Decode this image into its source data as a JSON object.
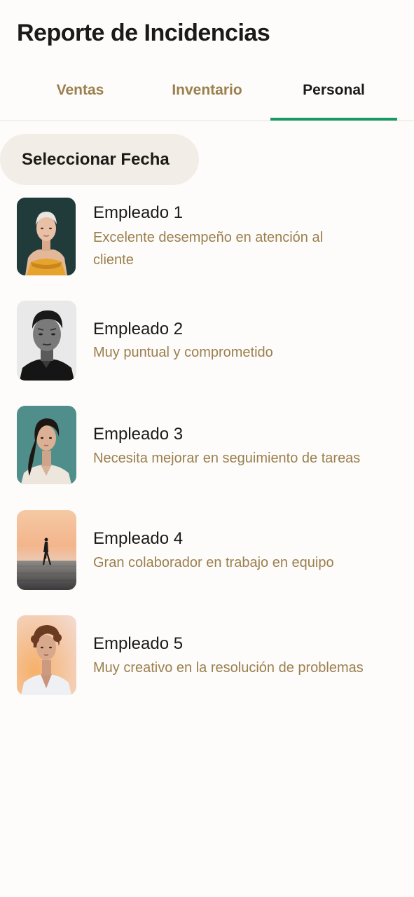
{
  "header": {
    "title": "Reporte de Incidencias"
  },
  "tabs": [
    {
      "label": "Ventas",
      "active": false
    },
    {
      "label": "Inventario",
      "active": false
    },
    {
      "label": "Personal",
      "active": true
    }
  ],
  "date_filter": {
    "label": "Seleccionar Fecha"
  },
  "employees": [
    {
      "name": "Empleado 1",
      "note": "Excelente desempeño en atención al cliente",
      "photo": "woman-portrait"
    },
    {
      "name": "Empleado 2",
      "note": "Muy puntual y comprometido",
      "photo": "man-portrait"
    },
    {
      "name": "Empleado 3",
      "note": "Necesita mejorar en seguimiento de tareas",
      "photo": "woman-portrait"
    },
    {
      "name": "Empleado 4",
      "note": "Gran colaborador en trabajo en equipo",
      "photo": "silhouette-sunset"
    },
    {
      "name": "Empleado 5",
      "note": "Muy creativo en la resolución de problemas",
      "photo": "woman-portrait"
    }
  ],
  "colors": {
    "accent": "#159a64",
    "muted_text": "#9b7f4c",
    "chip_background": "#f2eee7"
  }
}
